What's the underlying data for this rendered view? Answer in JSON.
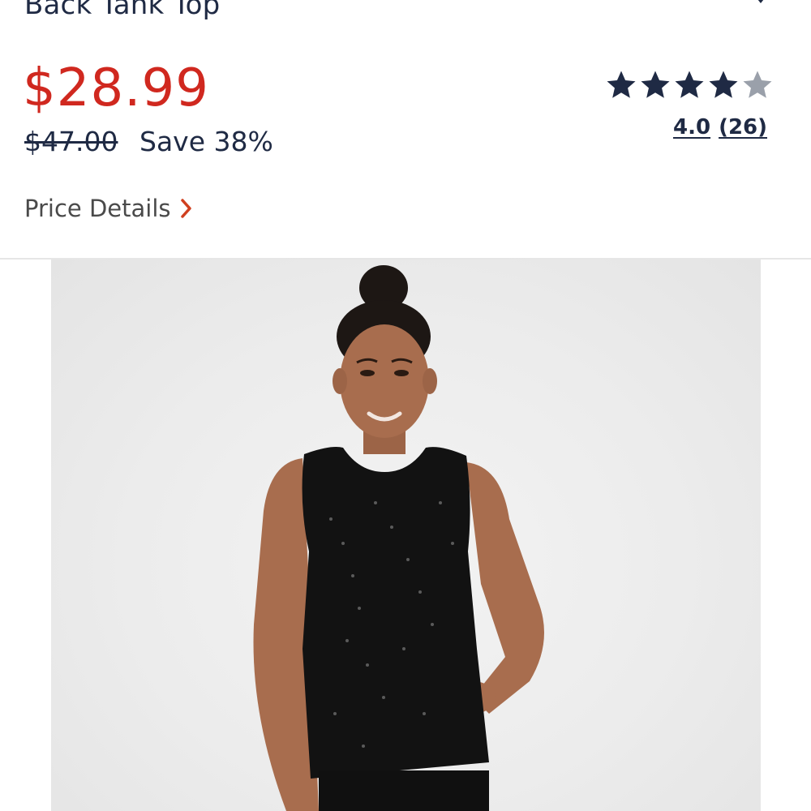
{
  "product": {
    "title": "Back Tank Top",
    "price_current": "$28.99",
    "price_original": "$47.00",
    "savings": "Save 38%",
    "rating": {
      "value": "4.0",
      "count": "(26)",
      "stars_filled": 4,
      "stars_total": 5
    },
    "price_details_label": "Price Details"
  },
  "icons": {
    "top_right": "heart-icon",
    "price_details_chevron": "chevron-right-icon",
    "rating": "star-icon"
  },
  "colors": {
    "sale_price": "#d0281f",
    "text_primary": "#1f2a44",
    "text_secondary": "#4a4a4a",
    "star_filled": "#1f2a44",
    "star_empty": "#9aa0aa",
    "chevron": "#d0401f",
    "image_background": "#ececec"
  }
}
